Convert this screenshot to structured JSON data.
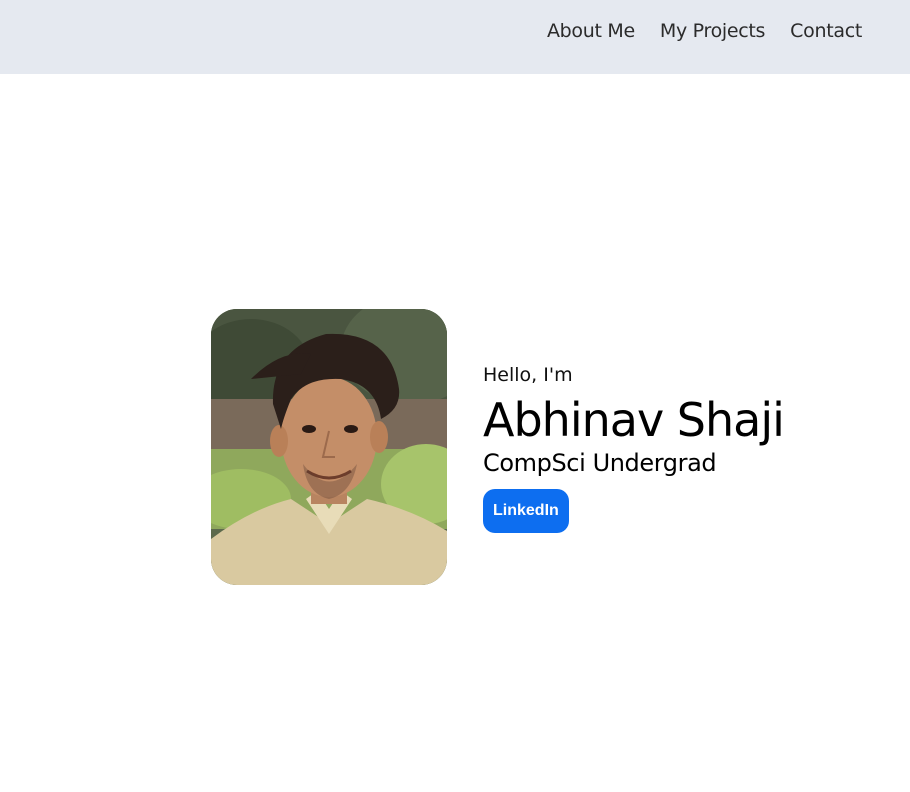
{
  "nav": {
    "links": [
      "About Me",
      "My Projects",
      "Contact"
    ]
  },
  "hero": {
    "greeting": "Hello, I'm",
    "name": "Abhinav Shaji",
    "role": "CompSci Undergrad",
    "linkedin_label": "LinkedIn",
    "photo_icon": "profile-photo"
  },
  "colors": {
    "navbar_bg": "#e5e9f0",
    "button_bg": "#0d6ef0",
    "button_text": "#ffffff"
  }
}
